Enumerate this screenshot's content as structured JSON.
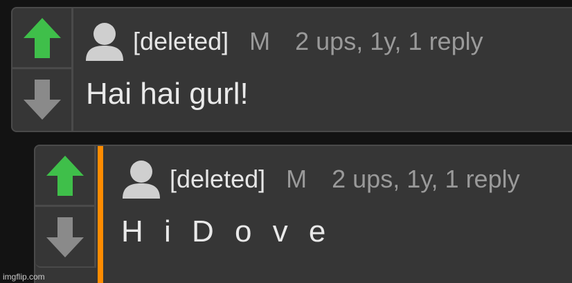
{
  "comments": [
    {
      "username": "[deleted]",
      "mod_tag": "M",
      "meta": "2 ups, 1y, 1 reply",
      "text": "Hai hai gurl!"
    },
    {
      "username": "[deleted]",
      "mod_tag": "M",
      "meta": "2 ups, 1y, 1 reply",
      "text": "H i D o v e"
    }
  ],
  "colors": {
    "upvote": "#3fbf4a",
    "downvote": "#8a8a8a",
    "thread_bar": "#ff8c00",
    "avatar": "#cfcfcf"
  },
  "icons": {
    "upvote": "arrow-up-icon",
    "downvote": "arrow-down-icon",
    "avatar": "user-avatar-icon"
  },
  "watermark": "imgflip.com"
}
